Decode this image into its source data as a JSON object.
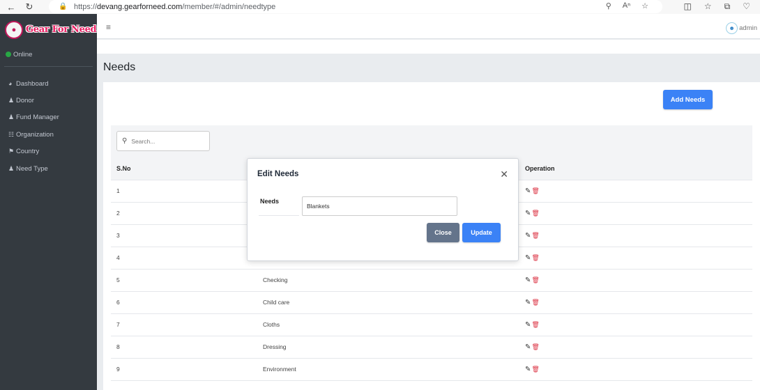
{
  "browser": {
    "url_prefix": "https://",
    "url_host": "devang.gearforneed.com",
    "url_path": "/member/#/admin/needtype"
  },
  "sidebar": {
    "brand": "Gear For Need",
    "status": "Online",
    "items": [
      {
        "label": "Dashboard",
        "icon": "dashboard-icon"
      },
      {
        "label": "Donor",
        "icon": "users-icon"
      },
      {
        "label": "Fund Manager",
        "icon": "user-tie-icon"
      },
      {
        "label": "Organization",
        "icon": "sitemap-icon"
      },
      {
        "label": "Country",
        "icon": "flag-icon"
      },
      {
        "label": "Need Type",
        "icon": "user-icon"
      }
    ]
  },
  "topnav": {
    "user": "admin"
  },
  "page": {
    "title": "Needs",
    "add_button": "Add Needs",
    "search_placeholder": "Search..."
  },
  "table": {
    "headers": [
      "S.No",
      "",
      "Operation"
    ],
    "rows": [
      {
        "sno": "1",
        "need": ""
      },
      {
        "sno": "2",
        "need": ""
      },
      {
        "sno": "3",
        "need": ""
      },
      {
        "sno": "4",
        "need": ""
      },
      {
        "sno": "5",
        "need": "Checking"
      },
      {
        "sno": "6",
        "need": "Child care"
      },
      {
        "sno": "7",
        "need": "Cloths"
      },
      {
        "sno": "8",
        "need": "Dressing"
      },
      {
        "sno": "9",
        "need": "Environment"
      }
    ]
  },
  "modal": {
    "title": "Edit Needs",
    "field_label": "Needs",
    "field_value": "Blankets",
    "close_button": "Close",
    "update_button": "Update"
  }
}
